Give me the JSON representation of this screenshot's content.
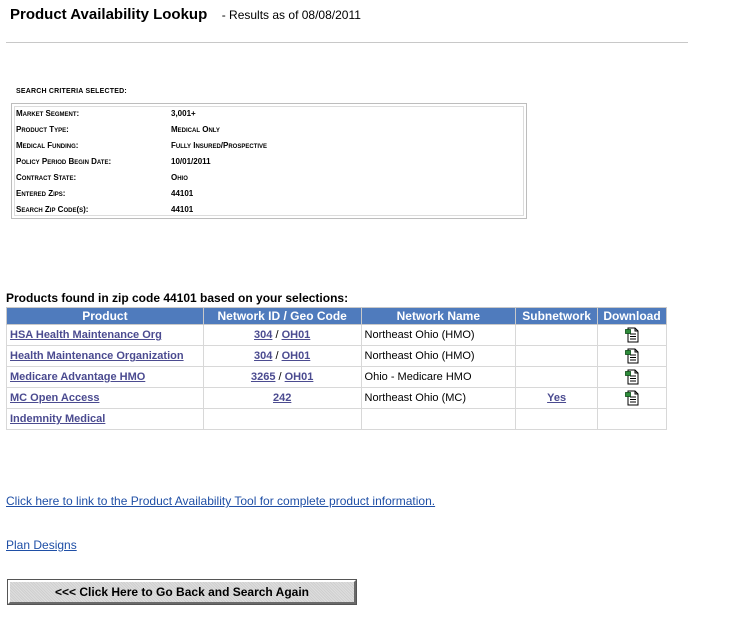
{
  "header": {
    "title": "Product Availability Lookup",
    "results_as_of": "- Results as of  08/08/2011"
  },
  "criteria": {
    "caption": "Search criteria selected:",
    "rows": [
      {
        "label": "Market Segment:",
        "value": "3,001+"
      },
      {
        "label": "Product Type:",
        "value": "Medical Only"
      },
      {
        "label": "Medical Funding:",
        "value": "Fully Insured/Prospective"
      },
      {
        "label": "Policy Period Begin Date:",
        "value": "10/01/2011"
      },
      {
        "label": "Contract State:",
        "value": "Ohio"
      },
      {
        "label": "Entered Zips:",
        "value": "44101"
      },
      {
        "label": "Search Zip Code(s):",
        "value": "44101"
      }
    ]
  },
  "results": {
    "heading": "Products found in zip code 44101 based on your selections:",
    "columns": [
      "Product",
      "Network ID / Geo Code",
      "Network Name",
      "Subnetwork",
      "Download"
    ],
    "rows": [
      {
        "product": "HSA Health Maintenance Org",
        "network_id": "304",
        "geo_code": "OH01",
        "network_name": "Northeast Ohio (HMO)",
        "subnetwork": "",
        "download_icon": "document-download-icon"
      },
      {
        "product": "Health Maintenance Organization",
        "network_id": "304",
        "geo_code": "OH01",
        "network_name": "Northeast Ohio (HMO)",
        "subnetwork": "",
        "download_icon": "document-download-icon"
      },
      {
        "product": "Medicare Advantage HMO",
        "network_id": "3265",
        "geo_code": "OH01",
        "network_name": "Ohio - Medicare HMO",
        "subnetwork": "",
        "download_icon": "document-download-icon"
      },
      {
        "product": "MC Open Access",
        "network_id": "242",
        "geo_code": "",
        "network_name": "Northeast Ohio (MC)",
        "subnetwork": "Yes",
        "download_icon": "document-download-icon"
      },
      {
        "product": "Indemnity Medical",
        "network_id": "",
        "geo_code": "",
        "network_name": "",
        "subnetwork": "",
        "download_icon": ""
      }
    ]
  },
  "links": {
    "tool_link": "Click here to link to the Product Availability Tool for complete product information.",
    "plan_designs": "Plan Designs"
  },
  "back_button": "<<< Click Here to Go Back and Search Again",
  "colors": {
    "table_header_bg": "#4f7bbd",
    "link_color": "#4b4b90",
    "plain_link_color": "#1f4fa6"
  }
}
